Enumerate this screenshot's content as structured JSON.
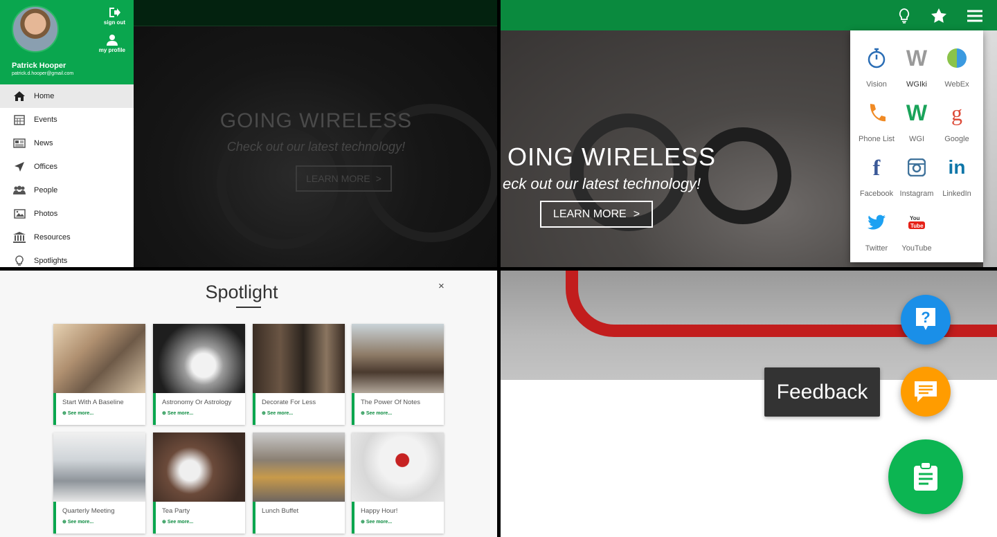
{
  "drawer": {
    "user_name": "Patrick Hooper",
    "user_email": "patrick.d.hooper@gmail.com",
    "sign_out_label": "sign out",
    "my_profile_label": "my profile",
    "items": [
      {
        "label": "Home",
        "icon": "home-icon"
      },
      {
        "label": "Events",
        "icon": "calendar-icon"
      },
      {
        "label": "News",
        "icon": "newspaper-icon"
      },
      {
        "label": "Offices",
        "icon": "location-arrow-icon"
      },
      {
        "label": "People",
        "icon": "users-icon"
      },
      {
        "label": "Photos",
        "icon": "image-icon"
      },
      {
        "label": "Resources",
        "icon": "bank-icon"
      },
      {
        "label": "Spotlights",
        "icon": "lightbulb-icon"
      }
    ]
  },
  "hero_dim": {
    "title": "GOING WIRELESS",
    "subtitle": "Check out our latest technology!",
    "button_label": "LEARN MORE",
    "button_arrow": ">"
  },
  "hero": {
    "title": "OING WIRELESS",
    "subtitle": "eck out our latest technology!",
    "button_label": "LEARN MORE",
    "button_arrow": ">"
  },
  "apps": [
    {
      "label": "Vision",
      "icon": "stopwatch-icon",
      "color": "#2a6db5"
    },
    {
      "label": "WGIki",
      "icon": "wiki-w-icon",
      "color": "#999999"
    },
    {
      "label": "WebEx",
      "icon": "webex-icon",
      "color": "#3b9ae0"
    },
    {
      "label": "Phone List",
      "icon": "phone-icon",
      "color": "#f08a24"
    },
    {
      "label": "WGI",
      "icon": "wgi-w-icon",
      "color": "#1aa35a"
    },
    {
      "label": "Google",
      "icon": "google-icon",
      "color": "#dd4b39"
    },
    {
      "label": "Facebook",
      "icon": "facebook-icon",
      "color": "#3b5998"
    },
    {
      "label": "Instagram",
      "icon": "instagram-icon",
      "color": "#3f729b"
    },
    {
      "label": "LinkedIn",
      "icon": "linkedin-icon",
      "color": "#0e76a8"
    },
    {
      "label": "Twitter",
      "icon": "twitter-icon",
      "color": "#1da1f2"
    },
    {
      "label": "YouTube",
      "icon": "youtube-icon",
      "color": "#e62117"
    }
  ],
  "spotlight": {
    "title": "Spotlight",
    "close_label": "×",
    "see_more_label": "See more...",
    "cards": [
      {
        "title": "Start With A Baseline",
        "more": true
      },
      {
        "title": "Astronomy Or Astrology",
        "more": true
      },
      {
        "title": "Decorate For Less",
        "more": true
      },
      {
        "title": "The Power Of Notes",
        "more": true
      },
      {
        "title": "Quarterly Meeting",
        "more": true
      },
      {
        "title": "Tea Party",
        "more": true
      },
      {
        "title": "Lunch Buffet",
        "more": false
      },
      {
        "title": "Happy Hour!",
        "more": true
      }
    ]
  },
  "feedback": {
    "tooltip": "Feedback",
    "help_color": "#1a8fe8",
    "feedback_color": "#ff9c00",
    "main_color": "#0cb552"
  },
  "colors": {
    "brand_green": "#0aa64e",
    "topbar_green": "#0a8a3e"
  }
}
